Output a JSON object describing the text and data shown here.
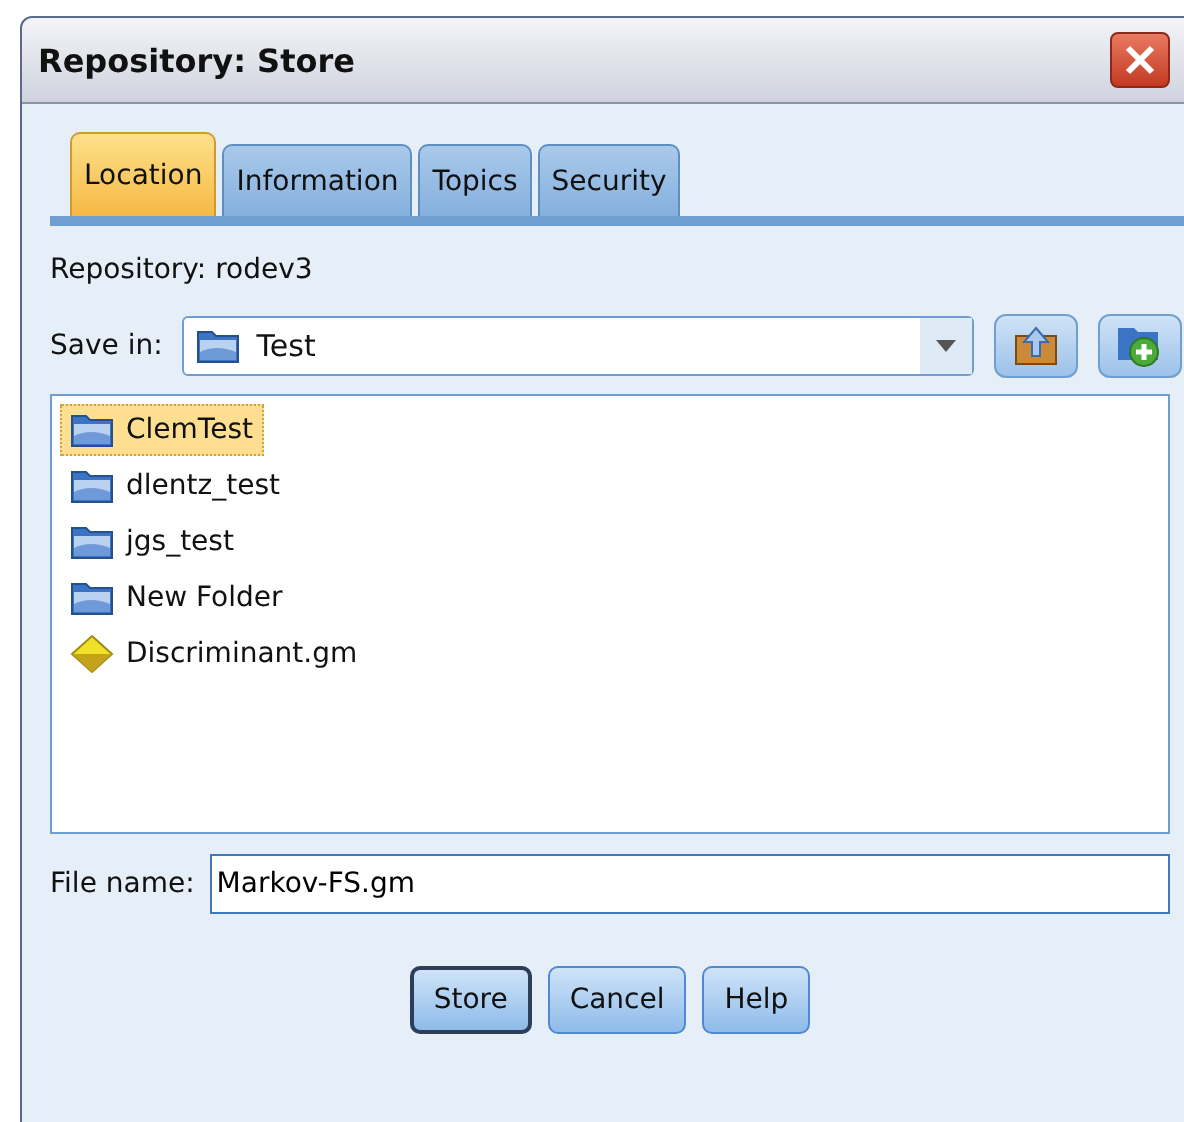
{
  "window": {
    "title": "Repository: Store"
  },
  "tabs": [
    {
      "label": "Location",
      "selected": true
    },
    {
      "label": "Information",
      "selected": false
    },
    {
      "label": "Topics",
      "selected": false
    },
    {
      "label": "Security",
      "selected": false
    }
  ],
  "repository_label": "Repository: rodev3",
  "save_in": {
    "label": "Save in:",
    "value": "Test"
  },
  "items": [
    {
      "name": "ClemTest",
      "kind": "folder",
      "selected": true
    },
    {
      "name": "dlentz_test",
      "kind": "folder",
      "selected": false
    },
    {
      "name": "jgs_test",
      "kind": "folder",
      "selected": false
    },
    {
      "name": "New Folder",
      "kind": "folder",
      "selected": false
    },
    {
      "name": "Discriminant.gm",
      "kind": "model",
      "selected": false
    }
  ],
  "file_name": {
    "label": "File name:",
    "value": "Markov-FS.gm"
  },
  "buttons": [
    {
      "label": "Store",
      "default": true
    },
    {
      "label": "Cancel",
      "default": false
    },
    {
      "label": "Help",
      "default": false
    }
  ]
}
